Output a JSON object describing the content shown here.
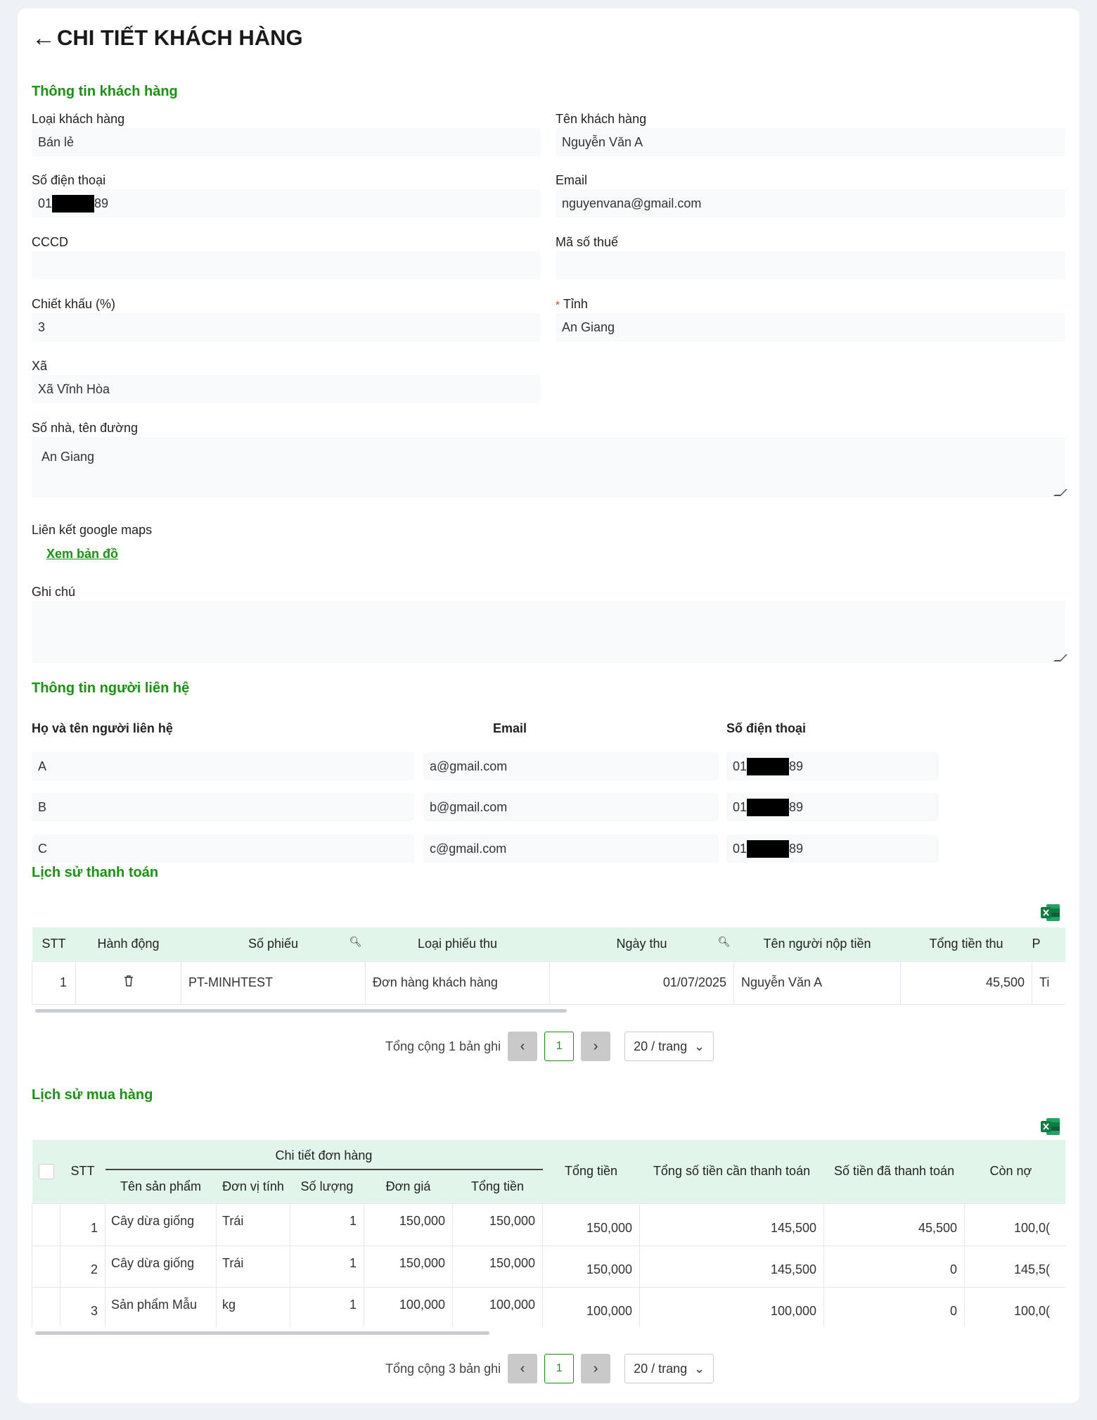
{
  "header": {
    "title": "CHI TIẾT KHÁCH HÀNG"
  },
  "customer": {
    "section": "Thông tin khách hàng",
    "type_label": "Loại khách hàng",
    "type_value": "Bán lẻ",
    "name_label": "Tên khách hàng",
    "name_value": "Nguyễn Văn A",
    "phone_label": "Số điện thoại",
    "phone_prefix": "01",
    "phone_suffix": "89",
    "email_label": "Email",
    "email_value": "nguyenvana@gmail.com",
    "cccd_label": "CCCD",
    "cccd_value": "",
    "tax_label": "Mã số thuế",
    "tax_value": "",
    "discount_label": "Chiết khấu (%)",
    "discount_value": "3",
    "province_required": "*",
    "province_label": "Tỉnh",
    "province_value": "An Giang",
    "ward_label": "Xã",
    "ward_value": "Xã Vĩnh Hòa",
    "address_label": "Số nhà, tên đường",
    "address_value": "An Giang",
    "maps_label": "Liên kết google maps",
    "maps_link": "Xem bản đồ",
    "note_label": "Ghi chú",
    "note_value": ""
  },
  "contacts": {
    "section": "Thông tin người liên hệ",
    "col_name": "Họ và tên người liên hệ",
    "col_email": "Email",
    "col_phone": "Số điện thoại",
    "rows": [
      {
        "name": "A",
        "email": "a@gmail.com",
        "phone_prefix": "01",
        "phone_suffix": "89"
      },
      {
        "name": "B",
        "email": "b@gmail.com",
        "phone_prefix": "01",
        "phone_suffix": "89"
      },
      {
        "name": "C",
        "email": "c@gmail.com",
        "phone_prefix": "01",
        "phone_suffix": "89"
      }
    ]
  },
  "payments": {
    "section": "Lịch sử thanh toán",
    "cols": [
      "STT",
      "Hành động",
      "Số phiếu",
      "Loại phiếu thu",
      "Ngày thu",
      "Tên người nộp tiền",
      "Tổng tiền thu",
      "P"
    ],
    "rows": [
      {
        "stt": "1",
        "code": "PT-MINHTEST",
        "type": "Đơn hàng khách hàng",
        "date": "01/07/2025",
        "payer": "Nguyễn Văn A",
        "total": "45,500",
        "extra": "Ti"
      }
    ],
    "total_text": "Tổng cộng 1 bản ghi",
    "page": "1",
    "page_size": "20 / trang"
  },
  "purchases": {
    "section": "Lịch sử mua hàng",
    "col_stt": "STT",
    "col_detail": "Chi tiết đơn hàng",
    "sub_cols": [
      "Tên sản phẩm",
      "Đơn vị tính",
      "Số lượng",
      "Đơn giá",
      "Tổng tiền"
    ],
    "col_total": "Tổng tiền",
    "col_need": "Tổng số tiền cần thanh toán",
    "col_paid": "Số tiền đã thanh toán",
    "col_debt": "Còn nợ",
    "rows": [
      {
        "stt": "1",
        "product": "Cây dừa giống",
        "unit": "Trái",
        "qty": "1",
        "price": "150,000",
        "line_total": "150,000",
        "total": "150,000",
        "need": "145,500",
        "paid": "45,500",
        "debt": "100,0("
      },
      {
        "stt": "2",
        "product": "Cây dừa giống",
        "unit": "Trái",
        "qty": "1",
        "price": "150,000",
        "line_total": "150,000",
        "total": "150,000",
        "need": "145,500",
        "paid": "0",
        "debt": "145,5("
      },
      {
        "stt": "3",
        "product": "Sản phẩm Mẫu",
        "unit": "kg",
        "qty": "1",
        "price": "100,000",
        "line_total": "100,000",
        "total": "100,000",
        "need": "100,000",
        "paid": "0",
        "debt": "100,0("
      }
    ],
    "total_text": "Tổng cộng 3 bản ghi",
    "page": "1",
    "page_size": "20 / trang"
  },
  "colors": {
    "accent": "#17950f",
    "header_bg": "#e2f5ea",
    "excel": "#1d7a3f"
  },
  "icons": [
    "back-arrow-icon",
    "search-icon",
    "trash-icon",
    "excel-icon",
    "chevron-left-icon",
    "chevron-right-icon",
    "chevron-down-icon"
  ]
}
